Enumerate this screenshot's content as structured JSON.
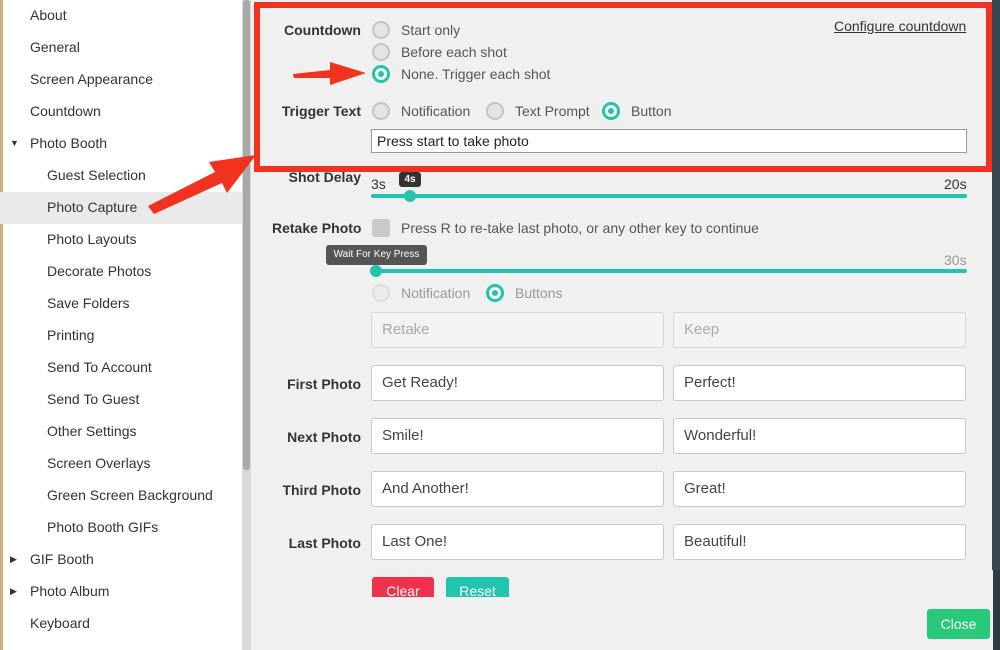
{
  "sidebar": {
    "items": [
      {
        "label": "About",
        "indent": 0
      },
      {
        "label": "General",
        "indent": 0
      },
      {
        "label": "Screen Appearance",
        "indent": 0
      },
      {
        "label": "Countdown",
        "indent": 0
      },
      {
        "label": "Photo Booth",
        "indent": 0,
        "caret": "▼"
      },
      {
        "label": "Guest Selection",
        "indent": 1
      },
      {
        "label": "Photo Capture",
        "indent": 1,
        "selected": true
      },
      {
        "label": "Photo Layouts",
        "indent": 1
      },
      {
        "label": "Decorate Photos",
        "indent": 1
      },
      {
        "label": "Save Folders",
        "indent": 1
      },
      {
        "label": "Printing",
        "indent": 1
      },
      {
        "label": "Send To Account",
        "indent": 1
      },
      {
        "label": "Send To Guest",
        "indent": 1
      },
      {
        "label": "Other Settings",
        "indent": 1
      },
      {
        "label": "Screen Overlays",
        "indent": 1
      },
      {
        "label": "Green Screen Background",
        "indent": 1
      },
      {
        "label": "Photo Booth GIFs",
        "indent": 1
      },
      {
        "label": "GIF Booth",
        "indent": 0,
        "caret": "▶"
      },
      {
        "label": "Photo Album",
        "indent": 0,
        "caret": "▶"
      },
      {
        "label": "Keyboard",
        "indent": 0
      }
    ]
  },
  "countdown": {
    "label": "Countdown",
    "options": [
      "Start only",
      "Before each shot",
      "None. Trigger each shot"
    ],
    "selected": "None. Trigger each shot",
    "configure_link": "Configure countdown"
  },
  "trigger_text": {
    "label": "Trigger Text",
    "options": [
      "Notification",
      "Text Prompt",
      "Button"
    ],
    "selected": "Button",
    "value": "Press start to take photo"
  },
  "shot_delay": {
    "label": "Shot Delay",
    "min_label": "3s",
    "max_label": "20s",
    "value_label": "4s"
  },
  "retake_photo": {
    "label": "Retake Photo",
    "checkbox_text": "Press R to re-take last photo, or any other key to continue",
    "slider_tooltip": "Wait For Key Press",
    "slider_max_label": "30s",
    "options": [
      "Notification",
      "Buttons"
    ],
    "selected": "Buttons",
    "retake_placeholder": "Retake",
    "keep_placeholder": "Keep"
  },
  "prompts": [
    {
      "label": "First Photo",
      "before": "Get Ready!",
      "after": "Perfect!"
    },
    {
      "label": "Next Photo",
      "before": "Smile!",
      "after": "Wonderful!"
    },
    {
      "label": "Third Photo",
      "before": "And Another!",
      "after": "Great!"
    },
    {
      "label": "Last Photo",
      "before": "Last One!",
      "after": "Beautiful!"
    }
  ],
  "buttons": {
    "clear": "Clear",
    "reset": "Reset",
    "close": "Close"
  },
  "colors": {
    "accent": "#22c4ad",
    "annotation": "#f0321e",
    "clear": "#f0314d",
    "close": "#28c97a"
  }
}
